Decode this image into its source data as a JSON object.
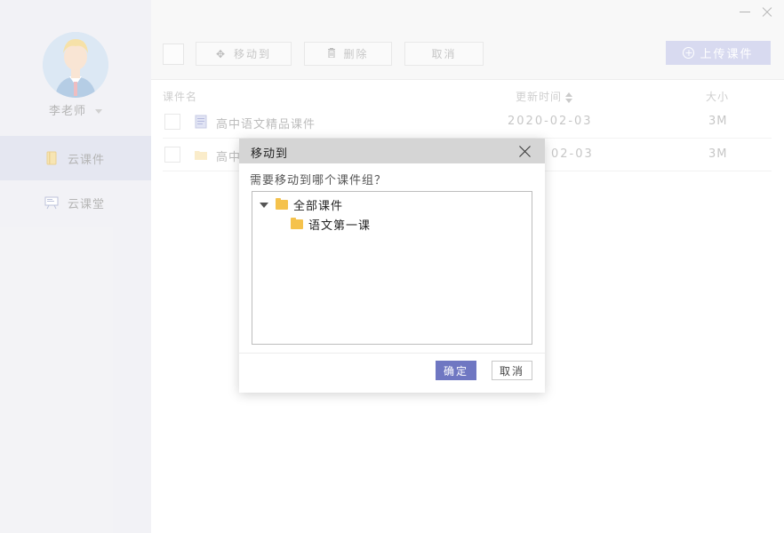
{
  "sidebar": {
    "user_name": "李老师",
    "items": [
      {
        "label": "云课件",
        "icon": "book-icon",
        "active": true
      },
      {
        "label": "云课堂",
        "icon": "presentation-board-icon",
        "active": false
      }
    ]
  },
  "toolbar": {
    "move_label": "移动到",
    "delete_label": "删除",
    "cancel_label": "取消",
    "upload_label": "上传课件"
  },
  "table": {
    "columns": [
      "课件名",
      "更新时间",
      "大小"
    ],
    "rows": [
      {
        "name": "高中语文精品课件",
        "date": "2020-02-03",
        "size": "3M",
        "type": "document"
      },
      {
        "name": "高中",
        "date": "02-03",
        "size": "3M",
        "type": "folder"
      }
    ]
  },
  "dialog": {
    "title": "移动到",
    "prompt": "需要移动到哪个课件组？",
    "tree": {
      "root": "全部课件",
      "children": [
        "语文第一课"
      ]
    },
    "ok_label": "确定",
    "cancel_label": "取消"
  },
  "colors": {
    "accent": "#6f77c2",
    "upload_button": "#c3c7e9",
    "sidebar_bg": "#ececf1",
    "sidebar_active": "#d8dbea",
    "folder": "#f5c24c"
  }
}
